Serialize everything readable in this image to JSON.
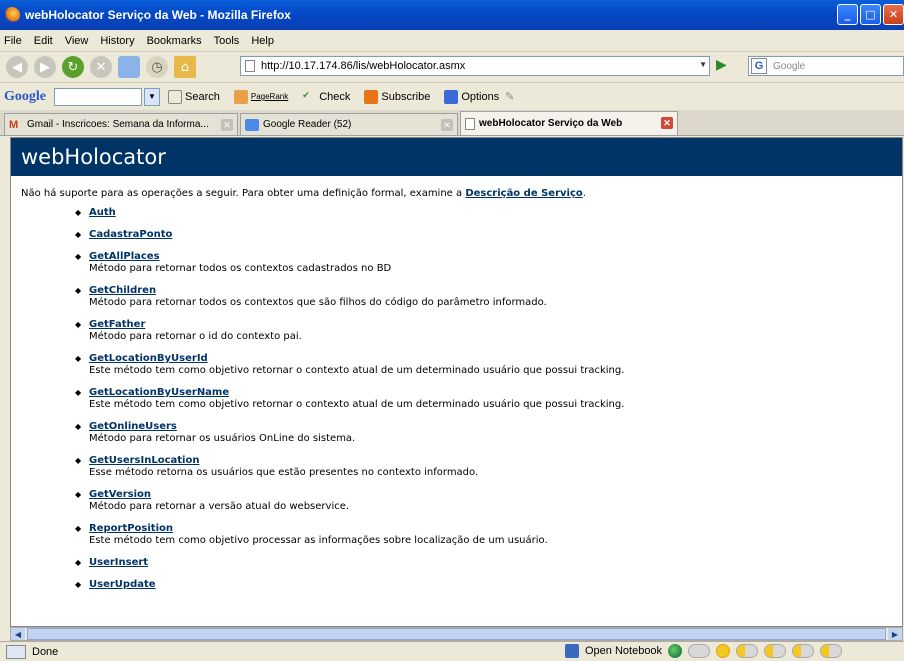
{
  "window": {
    "title": "webHolocator Serviço da Web - Mozilla Firefox"
  },
  "menu": [
    "File",
    "Edit",
    "View",
    "History",
    "Bookmarks",
    "Tools",
    "Help"
  ],
  "nav": {
    "url": "http://10.17.174.86/lis/webHolocator.asmx",
    "search_placeholder": "Google"
  },
  "google_toolbar": {
    "logo": "Google",
    "search_label": "Search",
    "pagerank": "PageRank",
    "check": "Check",
    "subscribe": "Subscribe",
    "options": "Options"
  },
  "tabs": [
    {
      "label": "Gmail - Inscricoes: Semana da Informa..."
    },
    {
      "label": "Google Reader (52)"
    },
    {
      "label": "webHolocator Serviço da Web"
    }
  ],
  "page": {
    "heading": "webHolocator",
    "intro_text": "Não há suporte para as operações a seguir. Para obter uma definição formal, examine a ",
    "intro_link": "Descrição de Serviço",
    "intro_end": ".",
    "operations": [
      {
        "name": "Auth",
        "desc": ""
      },
      {
        "name": "CadastraPonto",
        "desc": ""
      },
      {
        "name": "GetAllPlaces",
        "desc": "Método para retornar todos os contextos cadastrados no BD"
      },
      {
        "name": "GetChildren",
        "desc": "Método para retornar todos os contextos que são filhos do código do parâmetro informado."
      },
      {
        "name": "GetFather",
        "desc": "Método para retornar o id do contexto pai."
      },
      {
        "name": "GetLocationByUserId",
        "desc": "Este método tem como objetivo retornar o contexto atual de um determinado usuário que possui tracking."
      },
      {
        "name": "GetLocationByUserName",
        "desc": "Este método tem como objetivo retornar o contexto atual de um determinado usuário que possui tracking."
      },
      {
        "name": "GetOnlineUsers",
        "desc": "Método para retornar os usuários OnLine do sistema."
      },
      {
        "name": "GetUsersInLocation",
        "desc": "Esse método retorna os usuários que estão presentes no contexto informado."
      },
      {
        "name": "GetVersion",
        "desc": "Método para retornar a versão atual do webservice."
      },
      {
        "name": "ReportPosition",
        "desc": "Este método tem como objetivo processar as informações sobre localização de um usuário."
      },
      {
        "name": "UserInsert",
        "desc": ""
      },
      {
        "name": "UserUpdate",
        "desc": ""
      }
    ]
  },
  "status": {
    "text": "Done",
    "notebook": "Open Notebook"
  }
}
